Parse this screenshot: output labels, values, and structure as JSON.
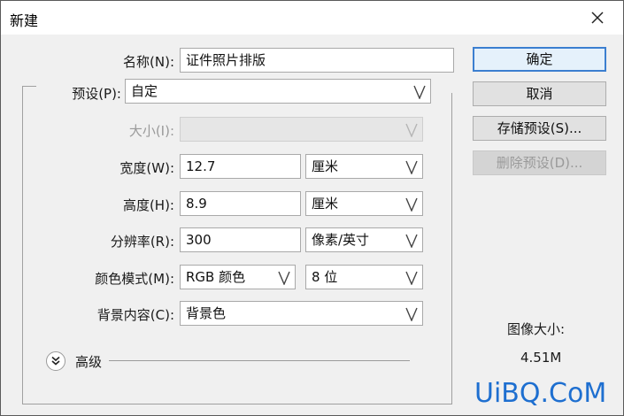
{
  "window": {
    "title": "新建"
  },
  "form": {
    "name": {
      "label": "名称(N):",
      "value": "证件照片排版"
    },
    "preset": {
      "label": "预设(P):",
      "value": "自定"
    },
    "size": {
      "label": "大小(I):",
      "value": ""
    },
    "width": {
      "label": "宽度(W):",
      "value": "12.7",
      "unit": "厘米"
    },
    "height": {
      "label": "高度(H):",
      "value": "8.9",
      "unit": "厘米"
    },
    "resolution": {
      "label": "分辨率(R):",
      "value": "300",
      "unit": "像素/英寸"
    },
    "color_mode": {
      "label": "颜色模式(M):",
      "value": "RGB 颜色",
      "depth": "8 位"
    },
    "background": {
      "label": "背景内容(C):",
      "value": "背景色"
    },
    "advanced": {
      "label": "高级"
    }
  },
  "buttons": {
    "ok": "确定",
    "cancel": "取消",
    "save_preset": "存储预设(S)...",
    "delete_preset": "删除预设(D)..."
  },
  "image_size": {
    "label": "图像大小:",
    "value": "4.51M"
  },
  "watermark": "UiBQ.CoM",
  "icons": {
    "close": "close-icon",
    "dropdown": "chevron-down-icon",
    "advanced": "double-chevron-down-icon"
  },
  "colors": {
    "dialog_bg": "#f0f0f0",
    "default_button_border": "#3c7fd0",
    "watermark": "#1e6fd0"
  }
}
